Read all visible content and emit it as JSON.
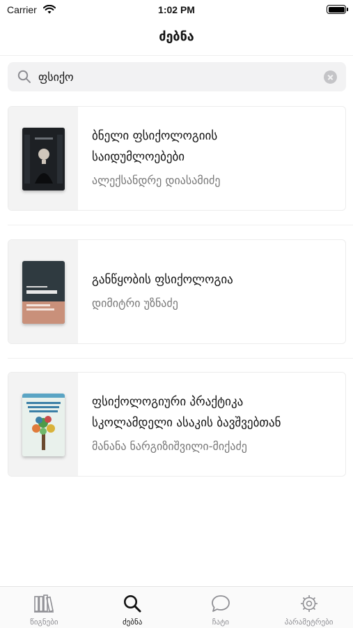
{
  "status_bar": {
    "carrier": "Carrier",
    "time": "1:02 PM",
    "battery_level": 1.0
  },
  "nav": {
    "title": "ძებნა"
  },
  "search": {
    "value": "ფსიქო",
    "placeholder": ""
  },
  "results": [
    {
      "title_line1": "ბნელი ფსიქოლოგიის",
      "title_line2": "საიდუმლოებები",
      "author": "ალექსანდრე დიასამიძე"
    },
    {
      "title_line1": "განწყობის ფსიქოლოგია",
      "title_line2": "",
      "author": "დიმიტრი უზნაძე"
    },
    {
      "title_line1": "ფსიქოლოგიური პრაქტიკა",
      "title_line2": "სკოლამდელი ასაკის ბავშვებთან",
      "author": "მანანა ნარგიზიშვილი-მიქაძე"
    }
  ],
  "tabs": [
    {
      "label": "წიგნები",
      "icon": "books-icon",
      "active": false
    },
    {
      "label": "ძებნა",
      "icon": "search-icon",
      "active": true
    },
    {
      "label": "ჩატი",
      "icon": "chat-bubble-icon",
      "active": false
    },
    {
      "label": "პარამეტრები",
      "icon": "gear-icon",
      "active": false
    }
  ],
  "colors": {
    "active_tab": "#111111",
    "inactive_tab": "#8e8e93",
    "secondary_text": "#777777"
  }
}
